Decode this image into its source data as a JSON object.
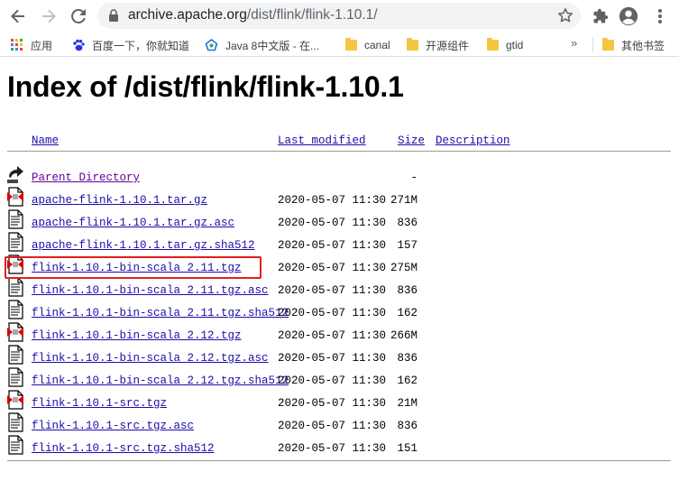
{
  "browser": {
    "url_host": "archive.apache.org",
    "url_path": "/dist/flink/flink-1.10.1/"
  },
  "bookmarks": [
    {
      "label": "应用",
      "icon": "apps-grid-icon"
    },
    {
      "label": "百度一下，你就知道",
      "icon": "baidu-paw-icon"
    },
    {
      "label": "Java 8中文版 - 在...",
      "icon": "java-doc-icon"
    },
    {
      "label": "canal",
      "icon": "folder-icon"
    },
    {
      "label": "开源组件",
      "icon": "folder-icon"
    },
    {
      "label": "gtid",
      "icon": "folder-icon"
    },
    {
      "label": "其他书签",
      "icon": "folder-icon"
    }
  ],
  "page": {
    "title": "Index of /dist/flink/flink-1.10.1",
    "columns": {
      "name": "Name",
      "last_modified": "Last modified",
      "size": "Size",
      "description": "Description"
    },
    "parent": {
      "name": "Parent Directory",
      "size": "-",
      "icon": "back-arrow-icon"
    },
    "files": [
      {
        "name": "apache-flink-1.10.1.tar.gz",
        "date": "2020-05-07 11:30",
        "size": "271M",
        "icon": "archive-file-icon"
      },
      {
        "name": "apache-flink-1.10.1.tar.gz.asc",
        "date": "2020-05-07 11:30",
        "size": "836",
        "icon": "text-file-icon"
      },
      {
        "name": "apache-flink-1.10.1.tar.gz.sha512",
        "date": "2020-05-07 11:30",
        "size": "157",
        "icon": "text-file-icon"
      },
      {
        "name": "flink-1.10.1-bin-scala_2.11.tgz",
        "date": "2020-05-07 11:30",
        "size": "275M",
        "icon": "archive-file-icon"
      },
      {
        "name": "flink-1.10.1-bin-scala_2.11.tgz.asc",
        "date": "2020-05-07 11:30",
        "size": "836",
        "icon": "text-file-icon"
      },
      {
        "name": "flink-1.10.1-bin-scala_2.11.tgz.sha512",
        "date": "2020-05-07 11:30",
        "size": "162",
        "icon": "text-file-icon"
      },
      {
        "name": "flink-1.10.1-bin-scala_2.12.tgz",
        "date": "2020-05-07 11:30",
        "size": "266M",
        "icon": "archive-file-icon"
      },
      {
        "name": "flink-1.10.1-bin-scala_2.12.tgz.asc",
        "date": "2020-05-07 11:30",
        "size": "836",
        "icon": "text-file-icon"
      },
      {
        "name": "flink-1.10.1-bin-scala_2.12.tgz.sha512",
        "date": "2020-05-07 11:30",
        "size": "162",
        "icon": "text-file-icon"
      },
      {
        "name": "flink-1.10.1-src.tgz",
        "date": "2020-05-07 11:30",
        "size": "21M",
        "icon": "archive-file-icon"
      },
      {
        "name": "flink-1.10.1-src.tgz.asc",
        "date": "2020-05-07 11:30",
        "size": "836",
        "icon": "text-file-icon"
      },
      {
        "name": "flink-1.10.1-src.tgz.sha512",
        "date": "2020-05-07 11:30",
        "size": "151",
        "icon": "text-file-icon"
      }
    ],
    "highlight_color": "#e02020",
    "link_color": "#1a0dab",
    "visited_color": "#660099"
  }
}
